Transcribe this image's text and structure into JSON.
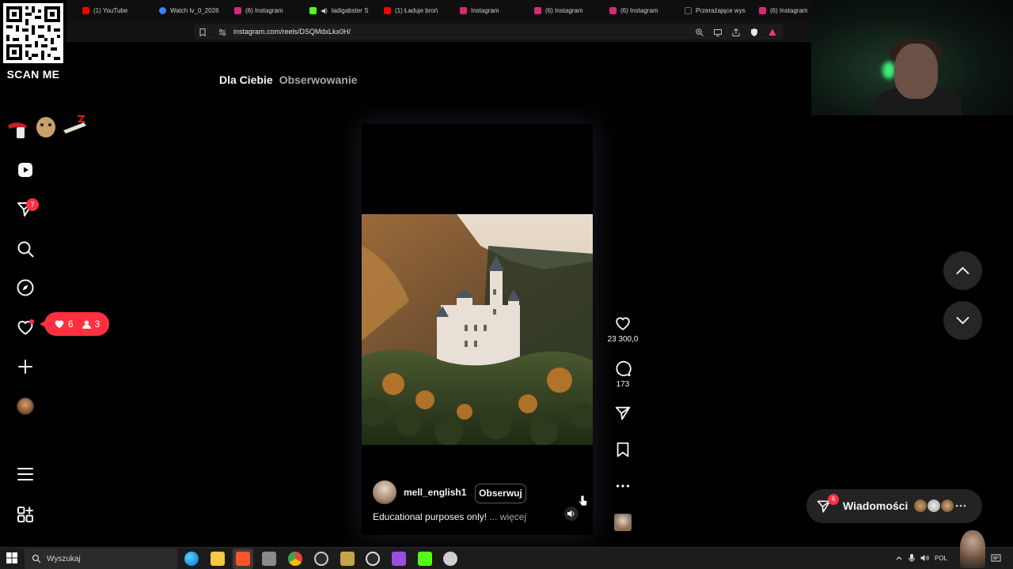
{
  "browser": {
    "tabs": [
      {
        "label": "(1) YouTube",
        "color": "#ff0000"
      },
      {
        "label": "Watch lv_0_2026",
        "color": "#3b82f6"
      },
      {
        "label": "(6) Instagram",
        "color": "#d62976"
      },
      {
        "label": "ladigabster S",
        "color": "#53fc18"
      },
      {
        "label": "(1) Ładuje broń",
        "color": "#ff0000"
      },
      {
        "label": "Instagram",
        "color": "#d62976"
      },
      {
        "label": "(6) Instagram",
        "color": "#d62976"
      },
      {
        "label": "(6) Instagram",
        "color": "#d62976"
      },
      {
        "label": "Przerażające wys",
        "color": "#111111"
      },
      {
        "label": "(6) Instagram",
        "color": "#d62976"
      }
    ],
    "url": "instagram.com/reels/DSQMdxLkx0H/"
  },
  "overlay": {
    "qr_label": "SCAN ME"
  },
  "sidebar": {
    "items": [
      {
        "icon": "reels-icon"
      },
      {
        "icon": "direct-send-icon",
        "badge": "7"
      },
      {
        "icon": "search-icon"
      },
      {
        "icon": "explore-compass-icon"
      },
      {
        "icon": "heart-icon"
      },
      {
        "icon": "create-plus-icon"
      },
      {
        "icon": "profile-avatar"
      },
      {
        "icon": "menu-icon"
      },
      {
        "icon": "more-apps-icon"
      }
    ],
    "notifications": {
      "likes": "6",
      "follows": "3"
    }
  },
  "feed_tabs": {
    "active": "Dla Ciebie",
    "other": "Obserwowanie"
  },
  "reel": {
    "username": "mell_english1",
    "follow_label": "Obserwuj",
    "caption": "Educational purposes only!",
    "more_label": "... więcej"
  },
  "actions": {
    "likes": "23 300,0",
    "comments": "173"
  },
  "messages": {
    "label": "Wiadomości",
    "badge": "6"
  },
  "taskbar": {
    "search_placeholder": "Wyszukaj",
    "tray_lang": "POL"
  },
  "colors": {
    "accent": "#ff3040",
    "background": "#000000"
  }
}
